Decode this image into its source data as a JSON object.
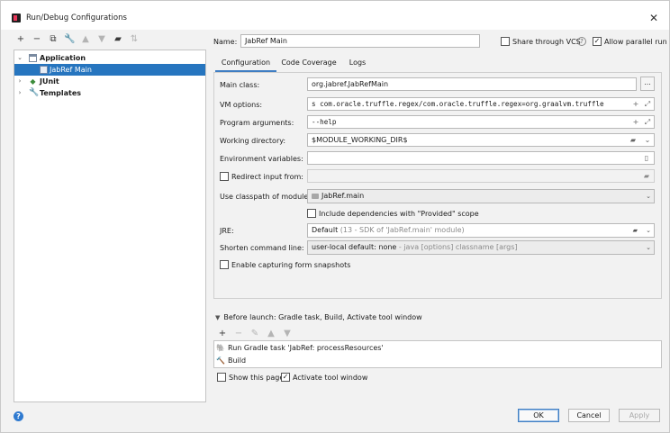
{
  "window": {
    "title": "Run/Debug Configurations"
  },
  "tree": {
    "items": [
      {
        "label": "Application"
      },
      {
        "label": "JabRef Main"
      },
      {
        "label": "JUnit"
      },
      {
        "label": "Templates"
      }
    ]
  },
  "header": {
    "name_label": "Name:",
    "name_value": "JabRef Main",
    "share_label": "Share through VCS",
    "share_checked": false,
    "parallel_label": "Allow parallel run",
    "parallel_checked": true
  },
  "tabs": [
    "Configuration",
    "Code Coverage",
    "Logs"
  ],
  "form": {
    "main_class_label": "Main class:",
    "main_class_value": "org.jabref.JabRefMain",
    "vm_options_label": "VM options:",
    "vm_options_value": "s com.oracle.truffle.regex/com.oracle.truffle.regex=org.graalvm.truffle",
    "program_args_label": "Program arguments:",
    "program_args_value": "--help",
    "working_dir_label": "Working directory:",
    "working_dir_value": "$MODULE_WORKING_DIR$",
    "env_vars_label": "Environment variables:",
    "env_vars_value": "",
    "redirect_label": "Redirect input from:",
    "redirect_value": "",
    "classpath_label": "Use classpath of module:",
    "classpath_value": "JabRef.main",
    "include_deps_label": "Include dependencies with \"Provided\" scope",
    "jre_label": "JRE:",
    "jre_value": "Default",
    "jre_hint": "(13 - SDK of 'JabRef.main' module)",
    "shorten_label": "Shorten command line:",
    "shorten_value": "user-local default: none",
    "shorten_hint": "- java [options] classname [args]",
    "snapshots_label": "Enable capturing form snapshots"
  },
  "before_launch": {
    "header": "Before launch: Gradle task, Build, Activate tool window",
    "items": [
      {
        "label": "Run Gradle task 'JabRef: processResources'"
      },
      {
        "label": "Build"
      }
    ],
    "show_page_label": "Show this page",
    "activate_label": "Activate tool window",
    "activate_checked": true
  },
  "buttons": {
    "ok": "OK",
    "cancel": "Cancel",
    "apply": "Apply"
  },
  "icons": {
    "close": "close-icon",
    "help": "help-icon",
    "check_mark": "✓",
    "question": "?",
    "chev_down": "⌄",
    "chev_right": "›"
  }
}
